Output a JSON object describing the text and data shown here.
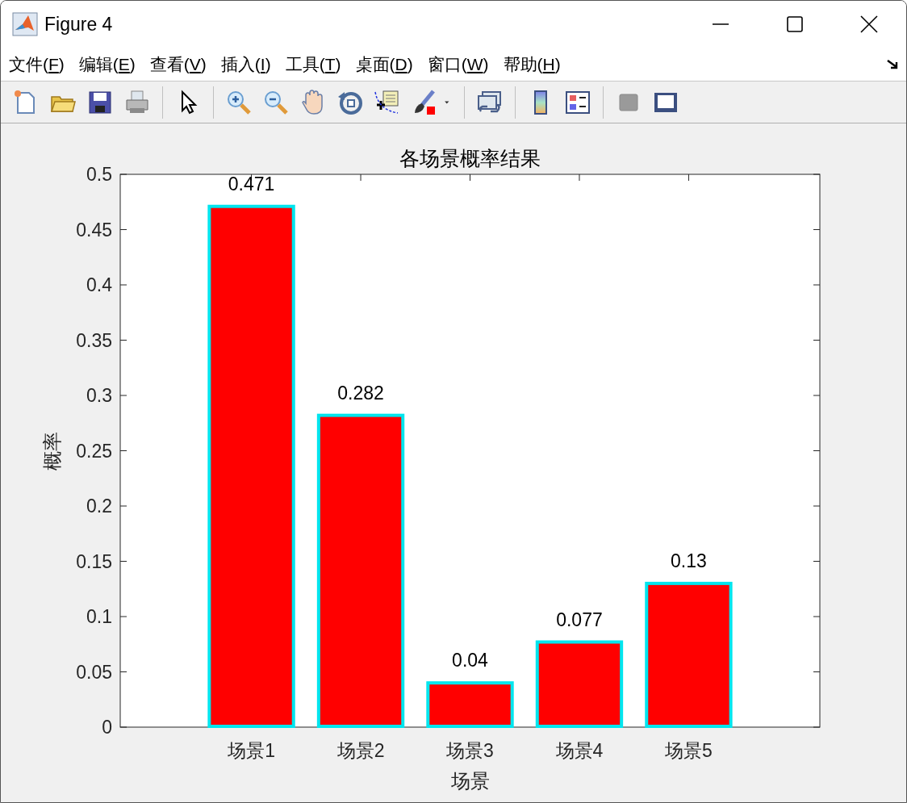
{
  "window": {
    "title": "Figure 4"
  },
  "menu": [
    {
      "label": "文件(F)"
    },
    {
      "label": "编辑(E)"
    },
    {
      "label": "查看(V)"
    },
    {
      "label": "插入(I)"
    },
    {
      "label": "工具(T)"
    },
    {
      "label": "桌面(D)"
    },
    {
      "label": "窗口(W)"
    },
    {
      "label": "帮助(H)"
    }
  ],
  "figure": {
    "chart_data": {
      "type": "bar",
      "title": "各场景概率结果",
      "xlabel": "场景",
      "ylabel": "概率",
      "categories": [
        "场景1",
        "场景2",
        "场景3",
        "场景4",
        "场景5"
      ],
      "series": [
        {
          "color": "#ff0000",
          "values": [
            0.471,
            0.282,
            0.04,
            0.077,
            0.13
          ]
        }
      ],
      "value_labels": [
        "0.471",
        "0.282",
        "0.04",
        "0.077",
        "0.13"
      ],
      "ylim": [
        0,
        0.5
      ],
      "yticks": [
        0,
        0.05,
        0.1,
        0.15,
        0.2,
        0.25,
        0.3,
        0.35,
        0.4,
        0.45,
        0.5
      ]
    }
  }
}
